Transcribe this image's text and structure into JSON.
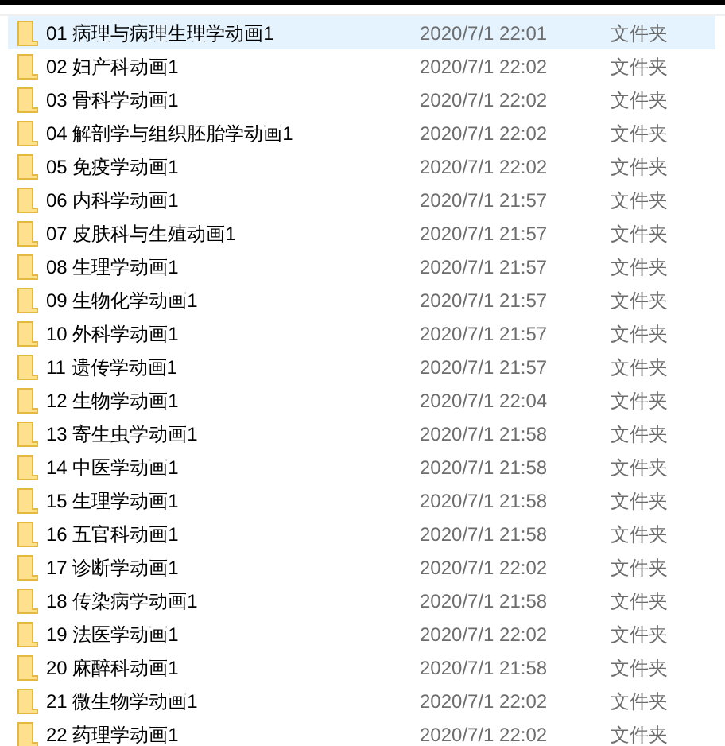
{
  "rows": [
    {
      "name": "01 病理与病理生理学动画1",
      "date": "2020/7/1 22:01",
      "type": "文件夹",
      "selected": true
    },
    {
      "name": "02 妇产科动画1",
      "date": "2020/7/1 22:02",
      "type": "文件夹",
      "selected": false
    },
    {
      "name": "03 骨科学动画1",
      "date": "2020/7/1 22:02",
      "type": "文件夹",
      "selected": false
    },
    {
      "name": "04 解剖学与组织胚胎学动画1",
      "date": "2020/7/1 22:02",
      "type": "文件夹",
      "selected": false
    },
    {
      "name": "05 免疫学动画1",
      "date": "2020/7/1 22:02",
      "type": "文件夹",
      "selected": false
    },
    {
      "name": "06 内科学动画1",
      "date": "2020/7/1 21:57",
      "type": "文件夹",
      "selected": false
    },
    {
      "name": "07 皮肤科与生殖动画1",
      "date": "2020/7/1 21:57",
      "type": "文件夹",
      "selected": false
    },
    {
      "name": "08 生理学动画1",
      "date": "2020/7/1 21:57",
      "type": "文件夹",
      "selected": false
    },
    {
      "name": "09 生物化学动画1",
      "date": "2020/7/1 21:57",
      "type": "文件夹",
      "selected": false
    },
    {
      "name": "10 外科学动画1",
      "date": "2020/7/1 21:57",
      "type": "文件夹",
      "selected": false
    },
    {
      "name": "11 遗传学动画1",
      "date": "2020/7/1 21:57",
      "type": "文件夹",
      "selected": false
    },
    {
      "name": "12 生物学动画1",
      "date": "2020/7/1 22:04",
      "type": "文件夹",
      "selected": false
    },
    {
      "name": "13 寄生虫学动画1",
      "date": "2020/7/1 21:58",
      "type": "文件夹",
      "selected": false
    },
    {
      "name": "14 中医学动画1",
      "date": "2020/7/1 21:58",
      "type": "文件夹",
      "selected": false
    },
    {
      "name": "15 生理学动画1",
      "date": "2020/7/1 21:58",
      "type": "文件夹",
      "selected": false
    },
    {
      "name": "16 五官科动画1",
      "date": "2020/7/1 21:58",
      "type": "文件夹",
      "selected": false
    },
    {
      "name": "17 诊断学动画1",
      "date": "2020/7/1 22:02",
      "type": "文件夹",
      "selected": false
    },
    {
      "name": "18 传染病学动画1",
      "date": "2020/7/1 21:58",
      "type": "文件夹",
      "selected": false
    },
    {
      "name": "19 法医学动画1",
      "date": "2020/7/1 22:02",
      "type": "文件夹",
      "selected": false
    },
    {
      "name": "20 麻醉科动画1",
      "date": "2020/7/1 21:58",
      "type": "文件夹",
      "selected": false
    },
    {
      "name": "21 微生物学动画1",
      "date": "2020/7/1 22:02",
      "type": "文件夹",
      "selected": false
    },
    {
      "name": "22 药理学动画1",
      "date": "2020/7/1 22:02",
      "type": "文件夹",
      "selected": false
    }
  ]
}
